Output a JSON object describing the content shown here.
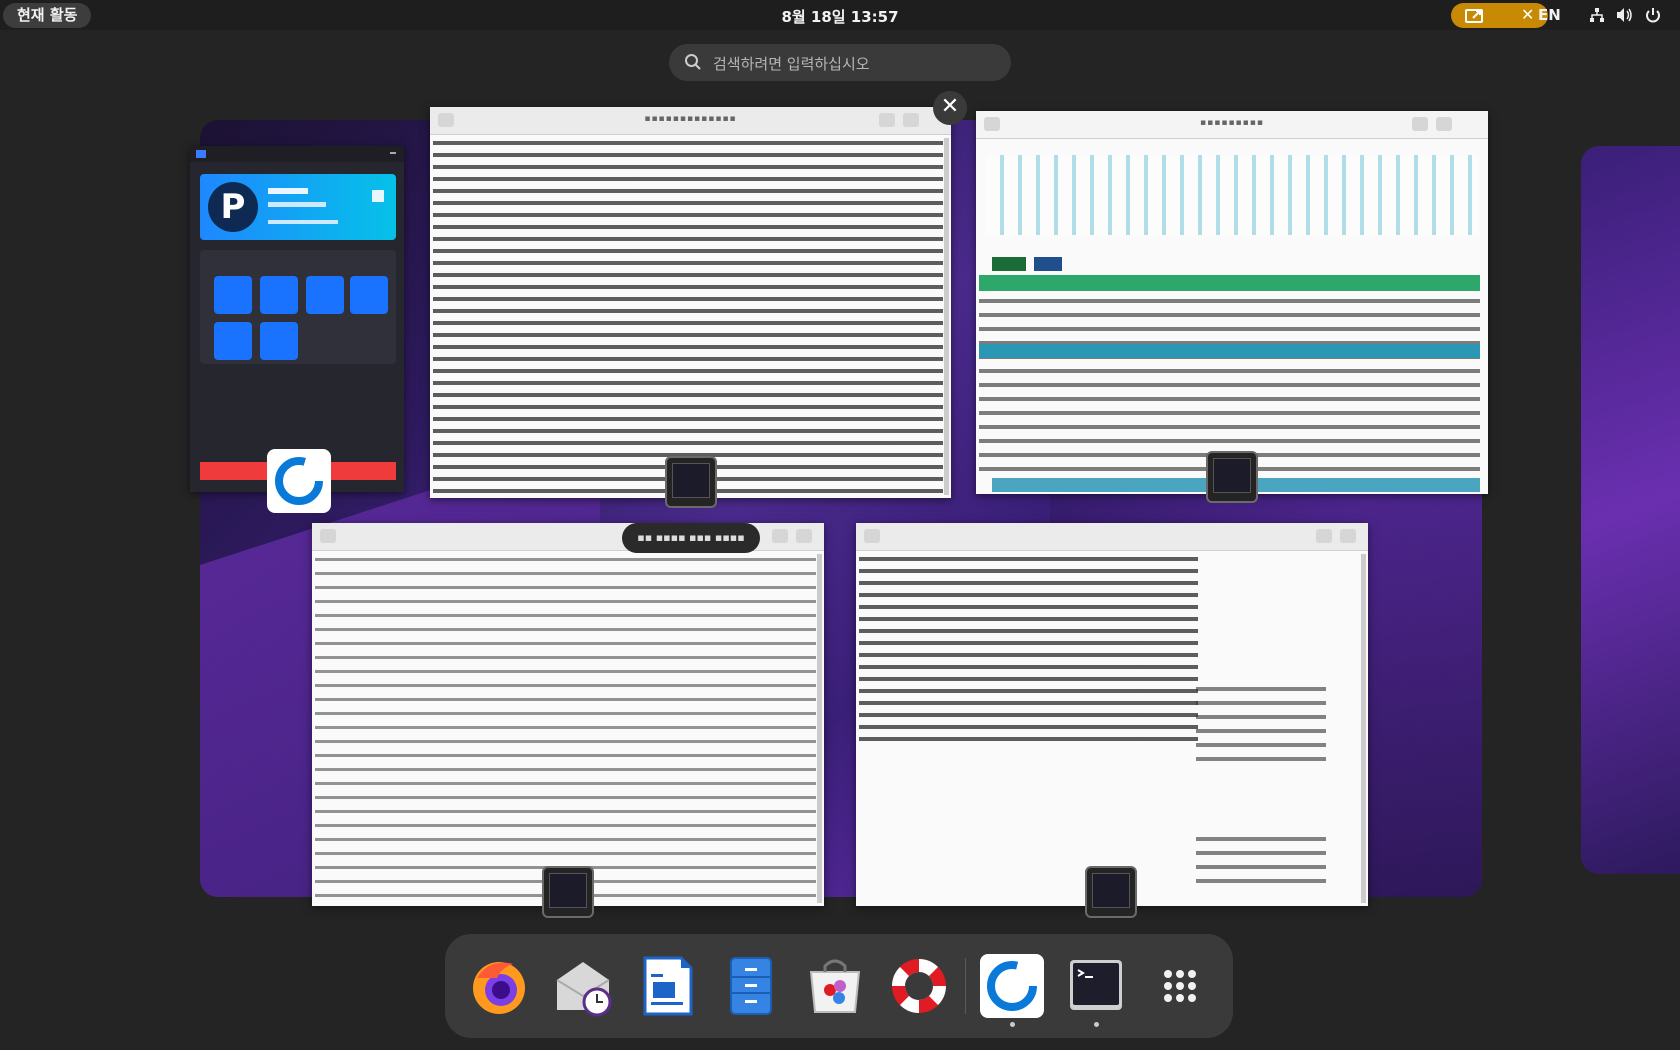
{
  "topbar": {
    "activities": "현재 활동",
    "clock": "8월 18일  13:57",
    "language": "EN"
  },
  "search": {
    "placeholder": "검색하려면 입력하십시오"
  },
  "windows": [
    {
      "id": "text-editor-1"
    },
    {
      "id": "system-monitor"
    },
    {
      "id": "text-editor-2"
    },
    {
      "id": "text-editor-3"
    }
  ],
  "dock": {
    "items": [
      "firefox",
      "mail-scheduler",
      "document-viewer",
      "file-manager",
      "software-store",
      "help",
      "vpn-client",
      "terminal",
      "app-grid"
    ]
  },
  "colors": {
    "panel": "#1e1e1e",
    "screenshare_accent": "#c88a04",
    "dock": "#3a3a3a",
    "wallpaper": "#4a2a8c"
  }
}
